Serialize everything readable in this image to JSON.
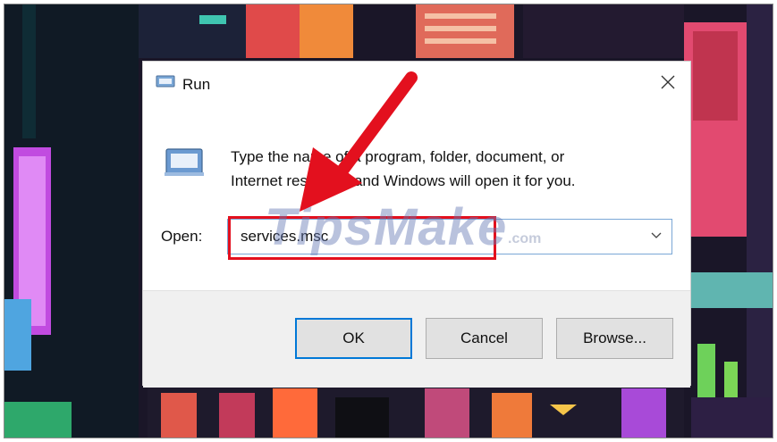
{
  "dialog": {
    "title": "Run",
    "description_line1": "Type the name of a program, folder, document, or",
    "description_line2": "Internet resource, and Windows will open it for you.",
    "open_label": "Open:",
    "open_value": "services.msc",
    "buttons": {
      "ok": "OK",
      "cancel": "Cancel",
      "browse": "Browse..."
    }
  },
  "watermark": {
    "main": "TipsMake",
    "suffix": ".com"
  },
  "colors": {
    "highlight": "#e3101e",
    "arrow": "#e3101e",
    "focus_border": "#0078d7"
  }
}
